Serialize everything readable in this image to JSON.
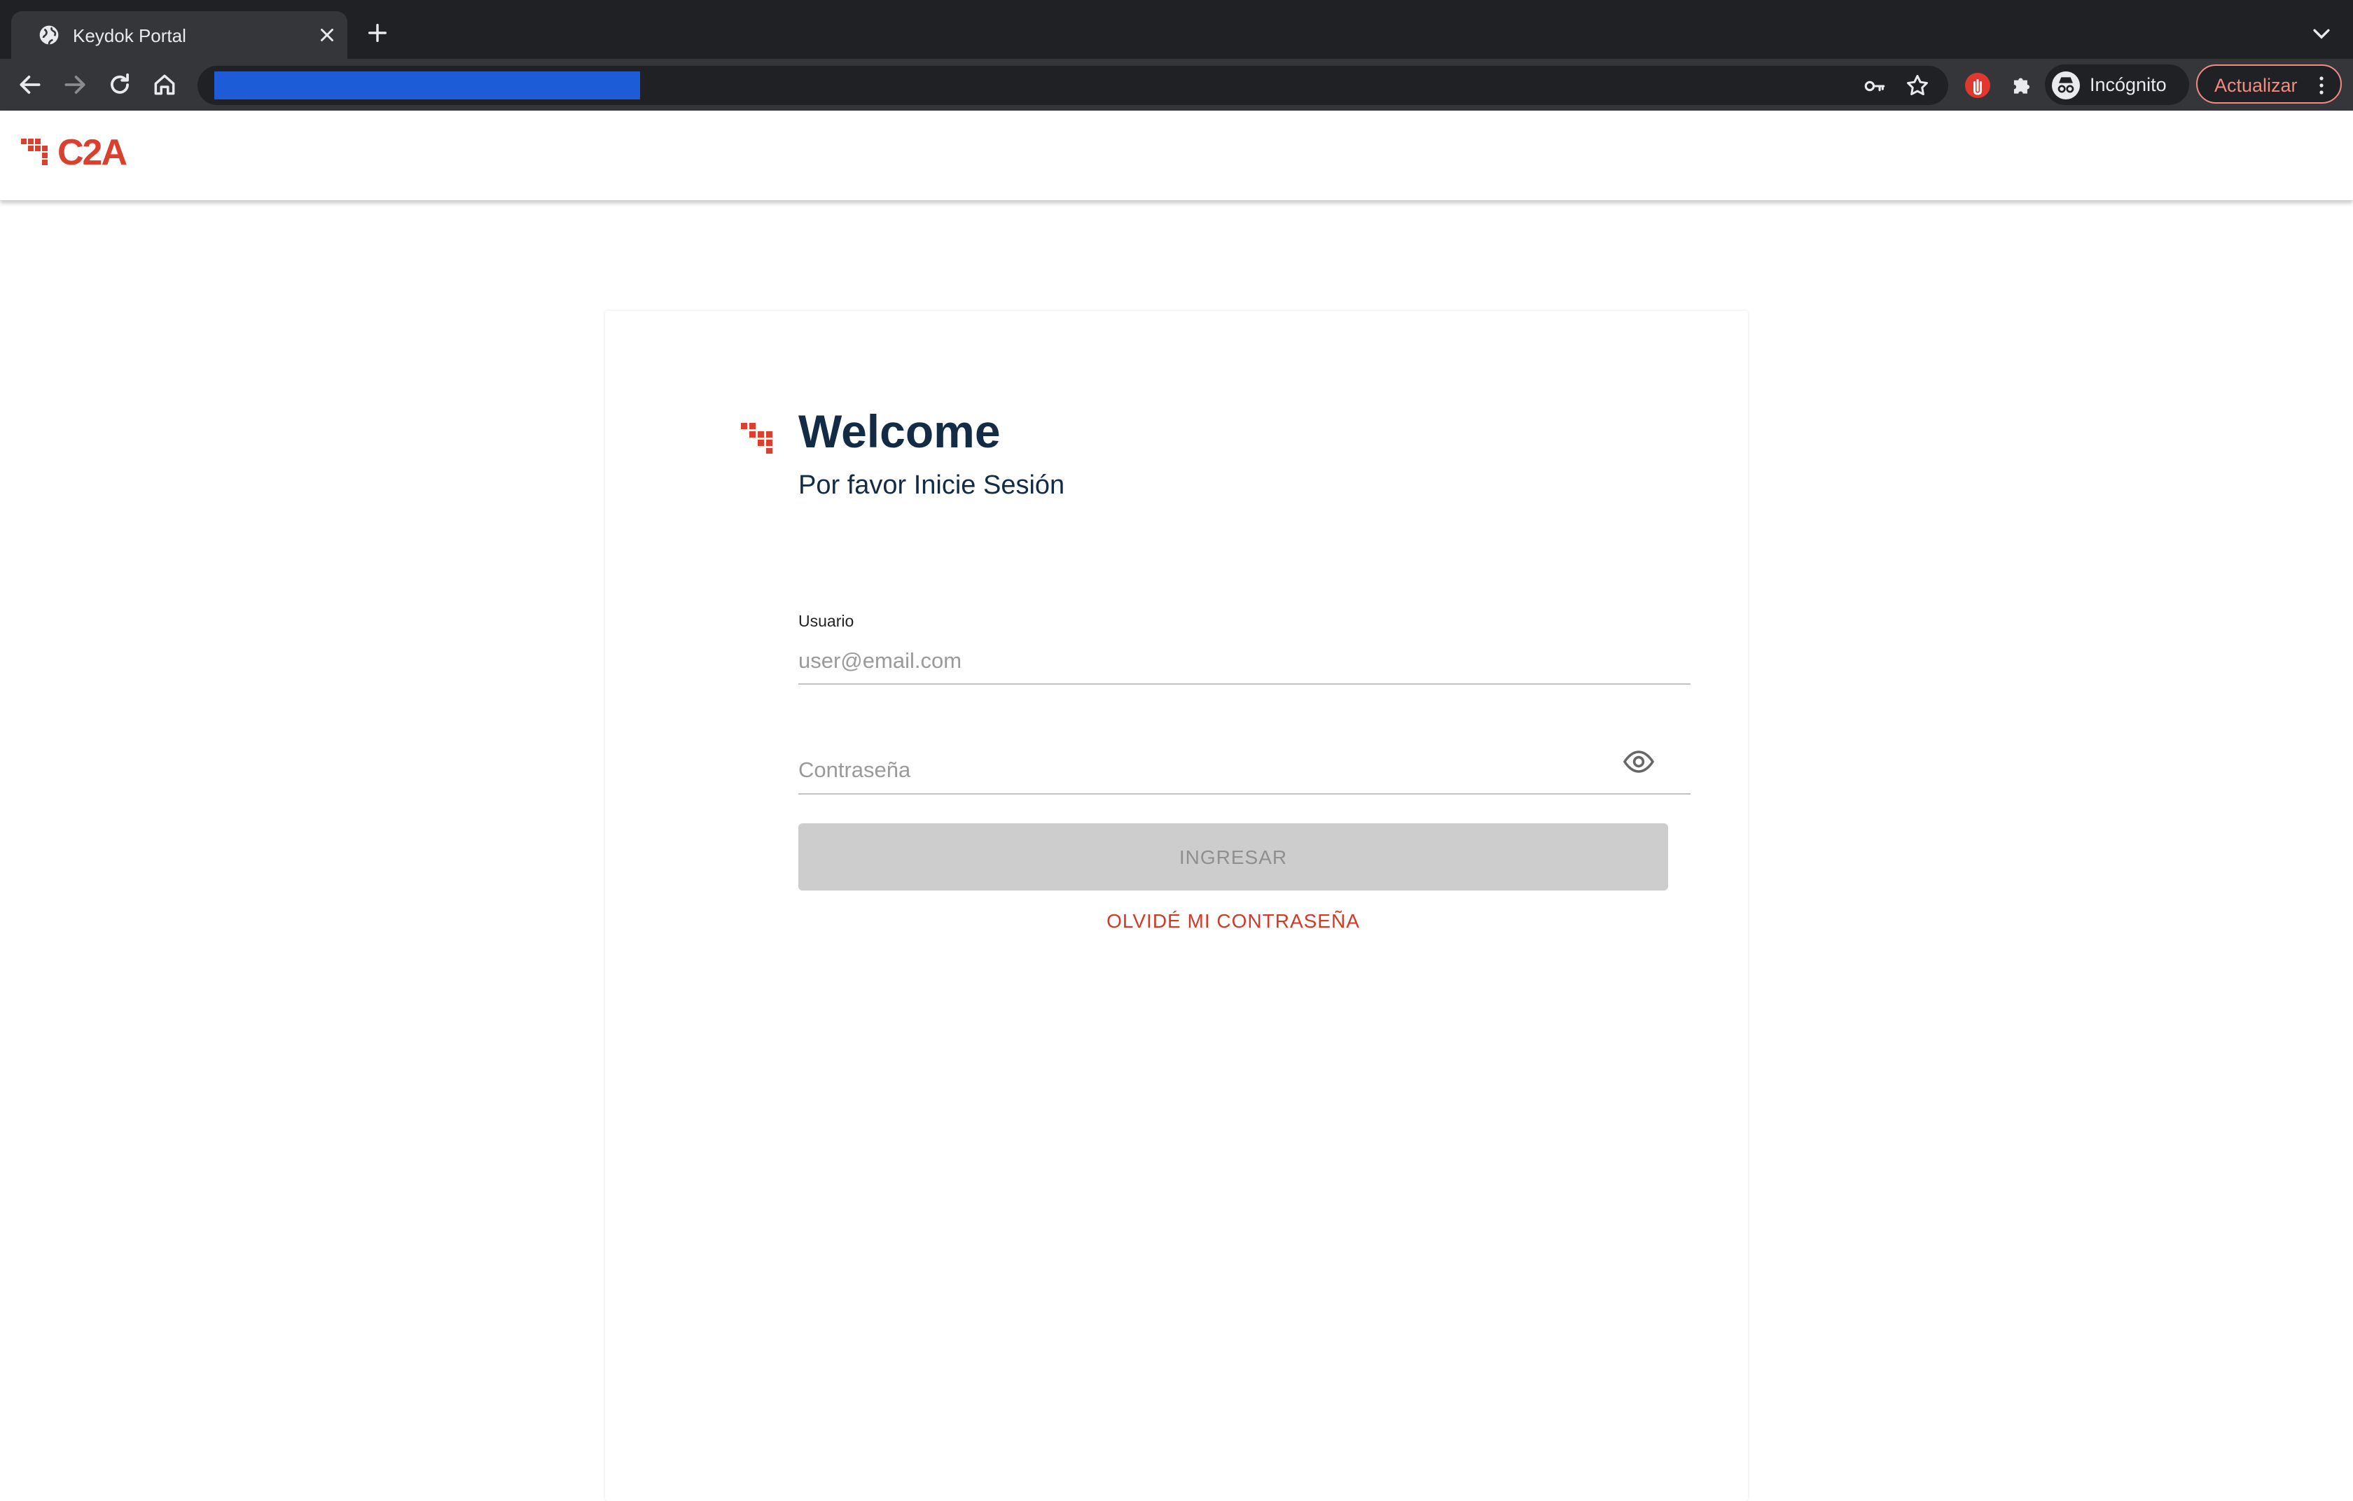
{
  "browser": {
    "tab_title": "Keydok Portal",
    "profile_label": "Incógnito",
    "update_label": "Actualizar",
    "address_redacted": true
  },
  "app": {
    "brand": "C2A"
  },
  "login": {
    "heading": "Welcome",
    "subheading": "Por favor Inicie Sesión",
    "username_label": "Usuario",
    "username_placeholder": "user@email.com",
    "username_value": "",
    "password_placeholder": "Contraseña",
    "password_value": "",
    "submit_label": "INGRESAR",
    "submit_enabled": false,
    "forgot_label": "OLVIDÉ MI CONTRASEÑA"
  },
  "colors": {
    "brand_red": "#d9412e",
    "heading_navy": "#132b45",
    "disabled_button": "#cdcdcd",
    "link_red": "#d23a27",
    "chrome_dark": "#202124",
    "chrome_toolbar": "#35363a",
    "update_accent": "#f28b82"
  },
  "icons": [
    "globe-icon",
    "close-icon",
    "plus-icon",
    "chevron-down-icon",
    "back-arrow-icon",
    "forward-arrow-icon",
    "reload-icon",
    "home-icon",
    "key-icon",
    "star-icon",
    "extension-icon",
    "puzzle-icon",
    "incognito-icon",
    "more-vert-icon",
    "eye-icon"
  ]
}
